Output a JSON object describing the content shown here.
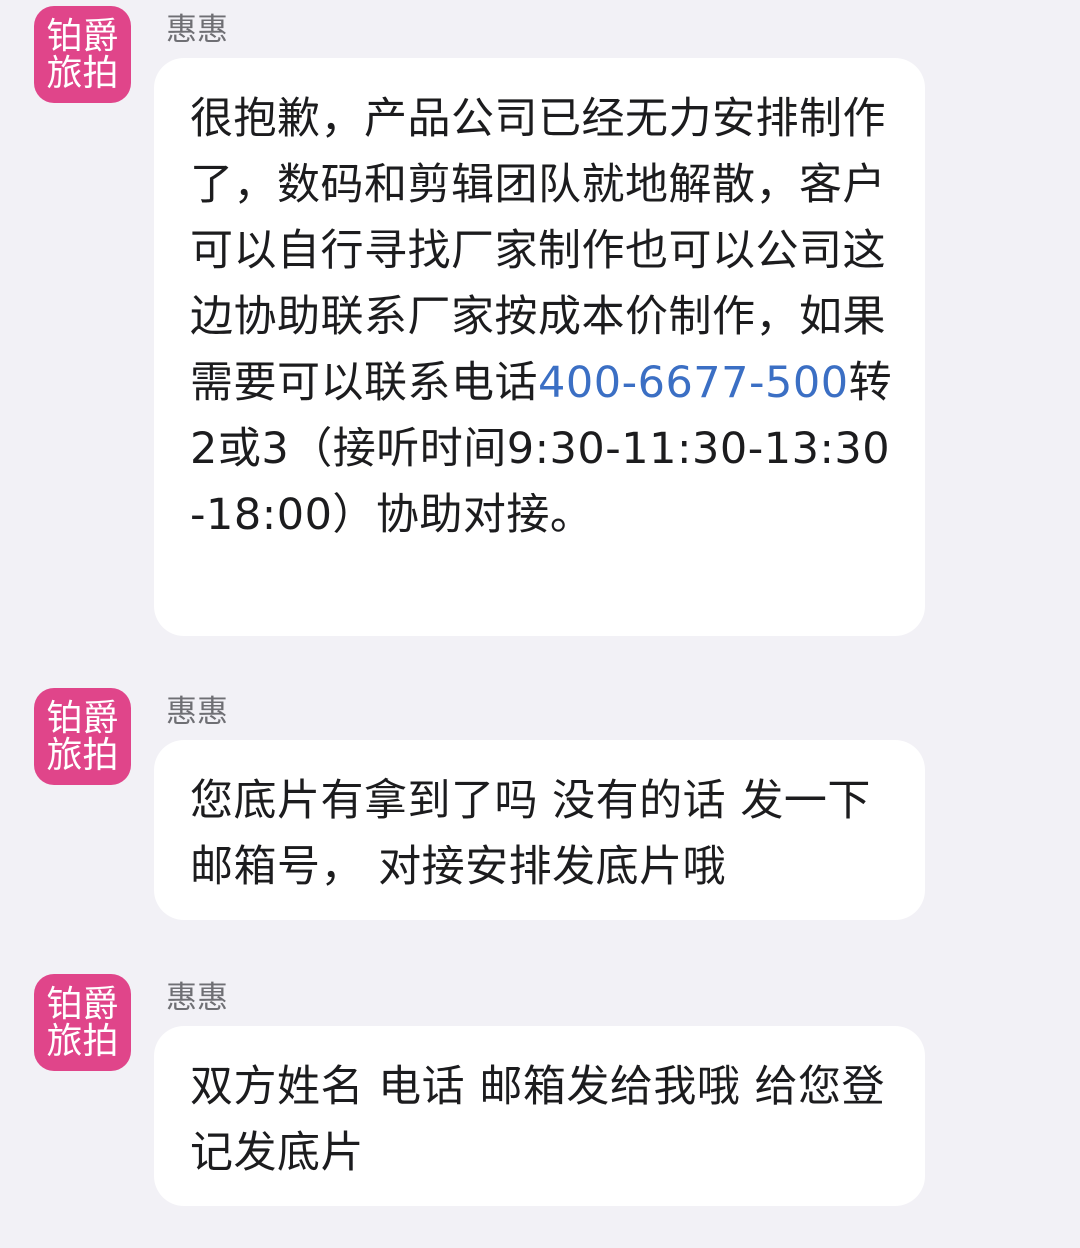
{
  "colors": {
    "background": "#f2f1f6",
    "avatar_bg": "#e0458a",
    "bubble_bg": "#ffffff",
    "link": "#3b6fc4",
    "sender_name": "#6f6f74"
  },
  "messages": [
    {
      "avatar": {
        "line1": "铂爵",
        "line2": "旅拍"
      },
      "sender": "惠惠",
      "text_before_link": "很抱歉，产品公司已经无力安排制作了，数码和剪辑团队就地解散，客户可以自行寻找厂家制作也可以公司这边协助联系厂家按成本价制作，如果需要可以联系电话",
      "phone_link": "400-6677-500",
      "text_after_link": "转2或3（接听时间9:30-11:30-13:30-18:00）协助对接。"
    },
    {
      "avatar": {
        "line1": "铂爵",
        "line2": "旅拍"
      },
      "sender": "惠惠",
      "text": "您底片有拿到了吗 没有的话 发一下邮箱号， 对接安排发底片哦"
    },
    {
      "avatar": {
        "line1": "铂爵",
        "line2": "旅拍"
      },
      "sender": "惠惠",
      "text": "双方姓名 电话 邮箱发给我哦  给您登记发底片"
    }
  ]
}
